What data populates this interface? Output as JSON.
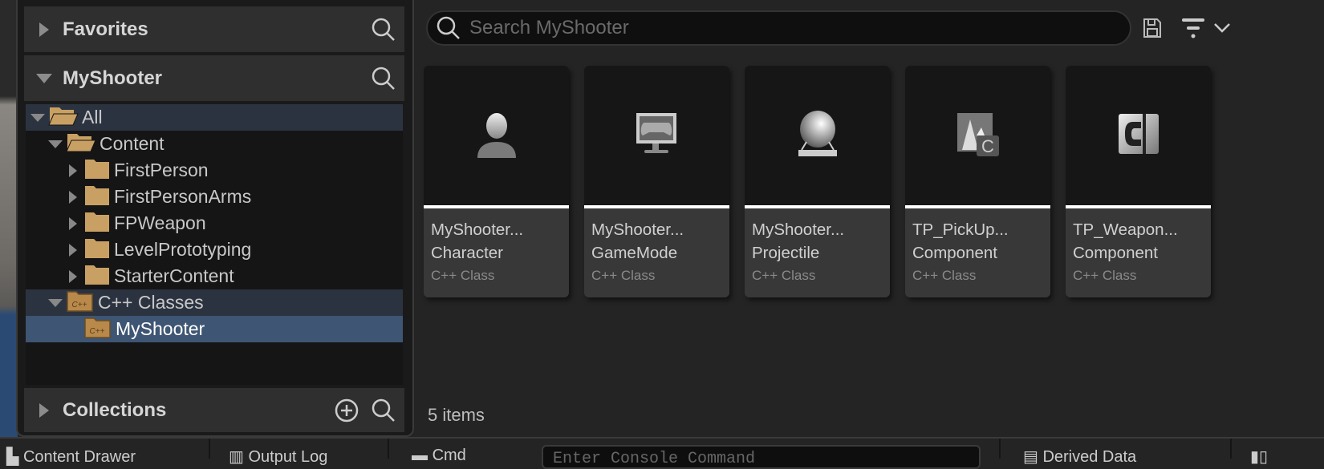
{
  "sidebar": {
    "favorites": {
      "label": "Favorites"
    },
    "project": {
      "label": "MyShooter"
    },
    "collections": {
      "label": "Collections"
    },
    "tree": [
      {
        "label": "All",
        "depth": 0,
        "expanded": true,
        "kind": "open"
      },
      {
        "label": "Content",
        "depth": 1,
        "expanded": true,
        "kind": "open"
      },
      {
        "label": "FirstPerson",
        "depth": 2,
        "expanded": false,
        "kind": "closed"
      },
      {
        "label": "FirstPersonArms",
        "depth": 2,
        "expanded": false,
        "kind": "closed"
      },
      {
        "label": "FPWeapon",
        "depth": 2,
        "expanded": false,
        "kind": "closed"
      },
      {
        "label": "LevelPrototyping",
        "depth": 2,
        "expanded": false,
        "kind": "closed"
      },
      {
        "label": "StarterContent",
        "depth": 2,
        "expanded": false,
        "kind": "closed"
      },
      {
        "label": "C++ Classes",
        "depth": 1,
        "expanded": true,
        "kind": "cpp"
      },
      {
        "label": "MyShooter",
        "depth": 2,
        "expanded": null,
        "kind": "cpp"
      }
    ]
  },
  "search": {
    "placeholder": "Search MyShooter"
  },
  "assets": [
    {
      "name1": "MyShooter...",
      "name2": "Character",
      "type": "C++ Class",
      "icon": "character-icon"
    },
    {
      "name1": "MyShooter...",
      "name2": "GameMode",
      "type": "C++ Class",
      "icon": "gamemode-icon"
    },
    {
      "name1": "MyShooter...",
      "name2": "Projectile",
      "type": "C++ Class",
      "icon": "projectile-sphere-icon"
    },
    {
      "name1": "TP_PickUp...",
      "name2": "Component",
      "type": "C++ Class",
      "icon": "scene-component-icon"
    },
    {
      "name1": "TP_Weapon...",
      "name2": "Component",
      "type": "C++ Class",
      "icon": "actor-component-icon"
    }
  ],
  "status": {
    "count": "5 items"
  },
  "bottom_bar": {
    "content_drawer": "Content Drawer",
    "output_log": "Output Log",
    "cmd": "Cmd",
    "console_placeholder": "Enter Console Command",
    "derived_data": "Derived Data"
  },
  "colors": {
    "folder": "#c9a063",
    "selected_row": "#3e5573",
    "hover_row": "#2c3340",
    "accent_bar": "#ffffff"
  }
}
